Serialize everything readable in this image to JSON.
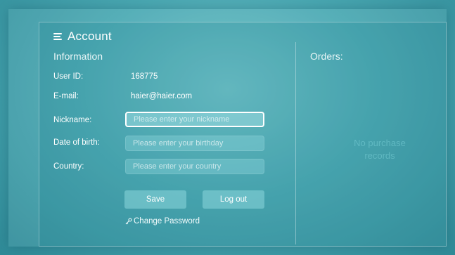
{
  "header": {
    "title": "Account"
  },
  "info": {
    "section_title": "Information",
    "user_id_label": "User ID:",
    "user_id_value": "168775",
    "email_label": "E-mail:",
    "email_value": "haier@haier.com",
    "nickname_label": "Nickname:",
    "nickname_placeholder": "Please enter your nickname",
    "birth_label": "Date of birth:",
    "birth_placeholder": "Please enter your birthday",
    "country_label": "Country:",
    "country_placeholder": "Please enter your country"
  },
  "actions": {
    "save_label": "Save",
    "logout_label": "Log out",
    "change_password_label": "Change Password"
  },
  "orders": {
    "title": "Orders:",
    "empty_line1": "No purchase",
    "empty_line2": "records"
  },
  "icons": {
    "menu": "menu-icon",
    "key": "key-icon"
  },
  "colors": {
    "background": "#4aa9b3",
    "focus_border": "#ffffff"
  }
}
